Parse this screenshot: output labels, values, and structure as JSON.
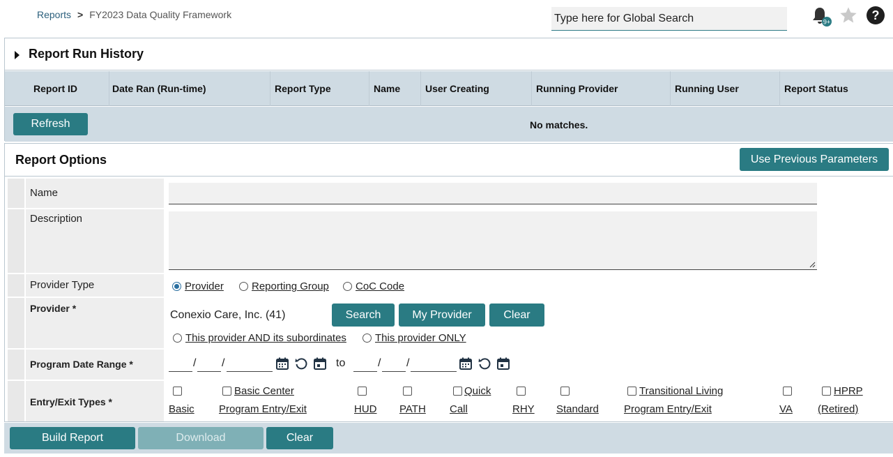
{
  "breadcrumb": {
    "root": "Reports",
    "separator": ">",
    "current": "FY2023 Data Quality Framework"
  },
  "global_search": {
    "placeholder": "Type here for Global Search"
  },
  "notifications": {
    "badge": "9+"
  },
  "history": {
    "title": "Report Run History",
    "columns": [
      "Report ID",
      "Date Ran (Run-time)",
      "Report Type",
      "Name",
      "User Creating",
      "Running Provider",
      "Running User",
      "Report Status"
    ],
    "refresh_label": "Refresh",
    "empty_text": "No matches."
  },
  "options": {
    "title": "Report Options",
    "use_previous_label": "Use Previous Parameters",
    "name_label": "Name",
    "name_value": "",
    "description_label": "Description",
    "description_value": "",
    "provider_type_label": "Provider Type",
    "provider_type_options": [
      "Provider",
      "Reporting Group",
      "CoC Code"
    ],
    "provider_type_selected": "Provider",
    "provider_label": "Provider *",
    "provider_value": "Conexio Care, Inc. (41)",
    "provider_search_label": "Search",
    "provider_my_label": "My Provider",
    "provider_clear_label": "Clear",
    "provider_scope_options": [
      "This provider AND its subordinates",
      "This provider ONLY"
    ],
    "date_range_label": "Program Date Range *",
    "date_to": "to",
    "date_slash": "/",
    "entry_exit_label": "Entry/Exit Types *",
    "entry_exit_types": [
      {
        "l1": "",
        "l2": "Basic"
      },
      {
        "l1": "Basic Center",
        "l2": "Program Entry/Exit"
      },
      {
        "l1": "",
        "l2": "HUD"
      },
      {
        "l1": "",
        "l2": "PATH"
      },
      {
        "l1": "Quick",
        "l2": "Call"
      },
      {
        "l1": "",
        "l2": "RHY"
      },
      {
        "l1": "",
        "l2": "Standard"
      },
      {
        "l1": "Transitional Living",
        "l2": "Program Entry/Exit"
      },
      {
        "l1": "",
        "l2": "VA"
      },
      {
        "l1": "HPRP",
        "l2": "(Retired)"
      }
    ]
  },
  "actions": {
    "build_label": "Build Report",
    "download_label": "Download",
    "clear_label": "Clear"
  },
  "colors": {
    "accent": "#2a7b83",
    "header_bg": "#cfdbe3",
    "link": "#2b5f7c"
  }
}
